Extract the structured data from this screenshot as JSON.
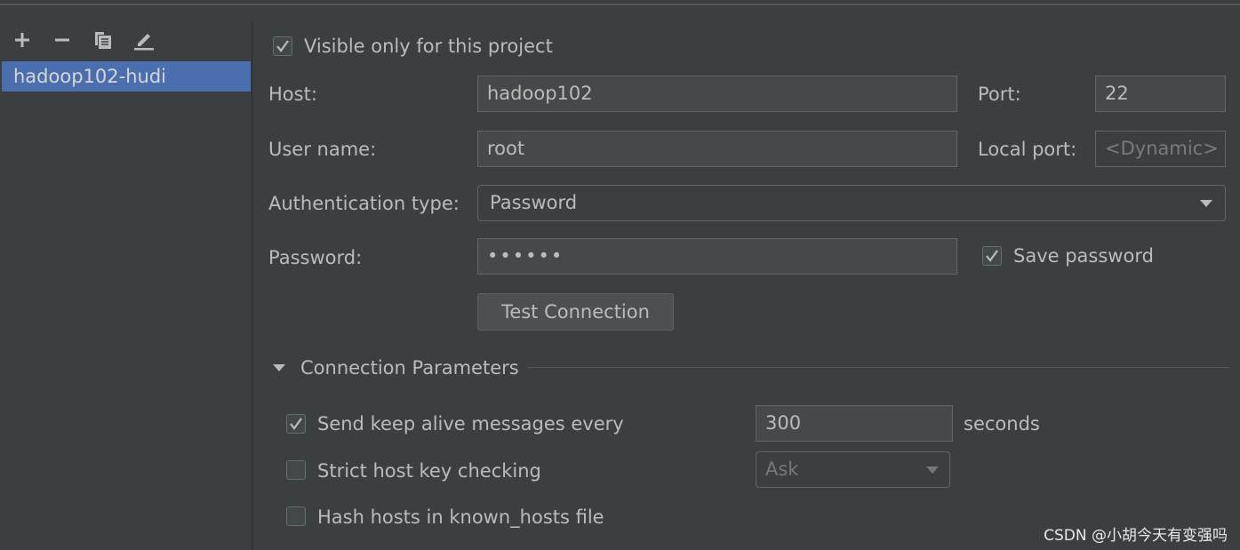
{
  "sidebar": {
    "toolbar": [
      "add-icon",
      "remove-icon",
      "copy-icon",
      "edit-icon"
    ],
    "items": [
      {
        "label": "hadoop102-hudi",
        "selected": true
      }
    ]
  },
  "form": {
    "visible_only": {
      "label": "Visible only for this project",
      "checked": true
    },
    "host": {
      "label": "Host:",
      "value": "hadoop102"
    },
    "port": {
      "label": "Port:",
      "value": "22"
    },
    "user": {
      "label": "User name:",
      "value": "root"
    },
    "local_port": {
      "label": "Local port:",
      "placeholder": "<Dynamic>"
    },
    "auth": {
      "label": "Authentication type:",
      "value": "Password"
    },
    "password": {
      "label": "Password:",
      "value": "••••••"
    },
    "save_password": {
      "label": "Save password",
      "checked": true
    },
    "test_button": "Test Connection"
  },
  "params": {
    "title": "Connection Parameters",
    "keep_alive": {
      "label": "Send keep alive messages every",
      "checked": true,
      "value": "300",
      "unit": "seconds"
    },
    "strict": {
      "label": "Strict host key checking",
      "checked": false,
      "value": "Ask"
    },
    "hash": {
      "label": "Hash hosts in known_hosts file",
      "checked": false
    }
  },
  "watermark": "CSDN @小胡今天有变强吗",
  "colors": {
    "background": "#3c3f41",
    "selection": "#4b6eaf",
    "input": "#45494a"
  }
}
